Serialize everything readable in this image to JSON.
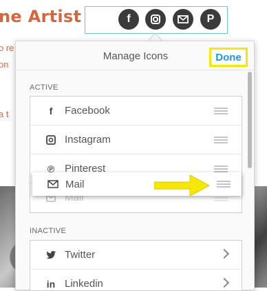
{
  "background": {
    "title": "ne Artist",
    "line1": "o re",
    "line2": "on",
    "line3": "a t"
  },
  "social_bar": {
    "icons": [
      {
        "name": "facebook",
        "glyph": "f"
      },
      {
        "name": "instagram",
        "glyph": "◘"
      },
      {
        "name": "mail",
        "glyph": "✉"
      },
      {
        "name": "pinterest",
        "glyph": "P"
      }
    ]
  },
  "panel": {
    "title": "Manage Icons",
    "done_label": "Done",
    "active_label": "ACTIVE",
    "inactive_label": "INACTIVE",
    "active_items": [
      {
        "label": "Facebook",
        "icon": "facebook-icon"
      },
      {
        "label": "Instagram",
        "icon": "instagram-icon"
      },
      {
        "label": "Pinterest",
        "icon": "pinterest-icon"
      },
      {
        "label": "Mail",
        "icon": "mail-icon"
      }
    ],
    "dragging_item": {
      "label": "Mail",
      "icon": "mail-icon"
    },
    "inactive_items": [
      {
        "label": "Twitter",
        "icon": "twitter-icon"
      },
      {
        "label": "Linkedin",
        "icon": "linkedin-icon"
      }
    ]
  },
  "colors": {
    "accent_orange": "#d9663a",
    "done_blue": "#1c9ad6",
    "highlight_yellow": "#f6e800",
    "bar_border": "#6fc3cf"
  }
}
